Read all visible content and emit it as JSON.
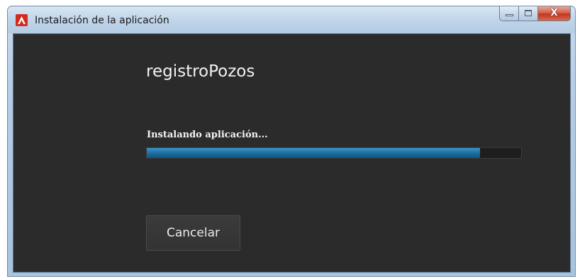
{
  "window": {
    "title": "Instalación de la aplicación",
    "close_glyph": "X"
  },
  "icons": {
    "app": "adobe-air-icon",
    "minimize": "minimize-icon",
    "maximize": "maximize-icon",
    "close": "close-icon"
  },
  "installer": {
    "app_name": "registroPozos",
    "status": "Instalando aplicación...",
    "progress": 0.89,
    "cancel_label": "Cancelar"
  },
  "colors": {
    "background": "#2b2b2b",
    "progress_fill": "#1c6fa3",
    "close_button": "#c2381e"
  }
}
